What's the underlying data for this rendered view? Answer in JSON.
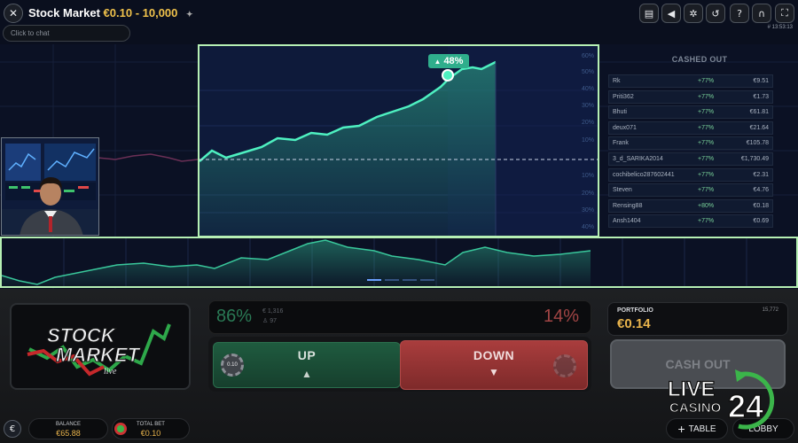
{
  "header": {
    "title": "Stock Market",
    "stake_range": "€0.10 - 10,000",
    "chat_placeholder": "Click to chat",
    "round_id": "# 13:53:13"
  },
  "chart": {
    "multiplier_label": "48%",
    "y_labels": [
      "60%",
      "50%",
      "40%",
      "30%",
      "20%",
      "10%",
      "10%",
      "20%",
      "30%",
      "40%"
    ]
  },
  "cashed_out": {
    "title": "CASHED OUT",
    "rows": [
      {
        "name": "Rk",
        "pct": "+77%",
        "amount": "€9.51"
      },
      {
        "name": "Priti362",
        "pct": "+77%",
        "amount": "€1.73"
      },
      {
        "name": "Bhuti",
        "pct": "+77%",
        "amount": "€61.81"
      },
      {
        "name": "deux071",
        "pct": "+77%",
        "amount": "€21.64"
      },
      {
        "name": "Frank",
        "pct": "+77%",
        "amount": "€105.78"
      },
      {
        "name": "3_d_SARIKA2014",
        "pct": "+77%",
        "amount": "€1,730.49"
      },
      {
        "name": "cochibelico287602441",
        "pct": "+77%",
        "amount": "€2.31"
      },
      {
        "name": "Steven",
        "pct": "+77%",
        "amount": "€4.76"
      },
      {
        "name": "Rensing88",
        "pct": "+80%",
        "amount": "€0.18"
      },
      {
        "name": "Ansh1404",
        "pct": "+77%",
        "amount": "€0.69"
      }
    ]
  },
  "betting": {
    "up_pct": "86%",
    "down_pct": "14%",
    "up_stake": "€ 1,316",
    "up_players": "97",
    "up_label": "UP",
    "down_label": "DOWN",
    "chip_value": "0.10"
  },
  "logo": {
    "line1": "STOCK",
    "line2": "MARKET",
    "line3": "live"
  },
  "portfolio": {
    "label": "PORTFOLIO",
    "value": "€0.14",
    "ratio": "15,772"
  },
  "cashout_button": "CASH OUT",
  "footer": {
    "currency_symbol": "€",
    "balance_label": "BALANCE",
    "balance_value": "€65.88",
    "total_bet_label": "TOTAL BET",
    "total_bet_value": "€0.10",
    "table_label": "TABLE",
    "lobby_label": "LOBBY"
  },
  "watermark": {
    "line1": "LIVE",
    "line2": "CASINO",
    "number": "24"
  },
  "colors": {
    "accent_green": "#2fae8c",
    "frame": "#b6f0b4",
    "down_red": "#a93d3d",
    "stake_gold": "#f0c24b"
  }
}
